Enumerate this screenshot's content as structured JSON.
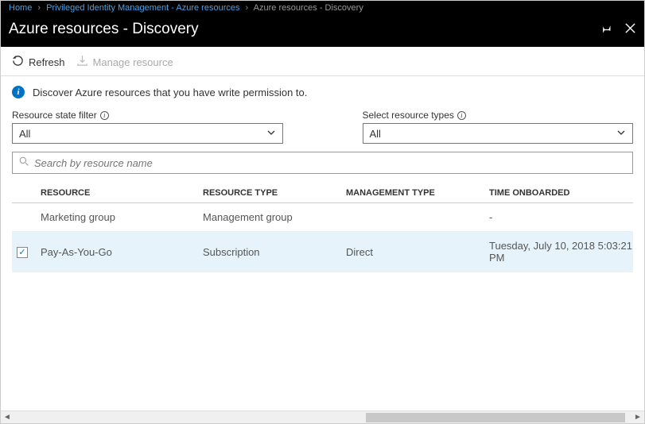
{
  "breadcrumb": {
    "home": "Home",
    "pim": "Privileged Identity Management - Azure resources",
    "current": "Azure resources - Discovery"
  },
  "title": "Azure resources - Discovery",
  "toolbar": {
    "refresh": "Refresh",
    "manage": "Manage resource"
  },
  "banner": "Discover Azure resources that you have write permission to.",
  "filters": {
    "state_label": "Resource state filter",
    "state_value": "All",
    "type_label": "Select resource types",
    "type_value": "All"
  },
  "search": {
    "placeholder": "Search by resource name"
  },
  "columns": {
    "resource": "RESOURCE",
    "type": "RESOURCE TYPE",
    "mgmt": "MANAGEMENT TYPE",
    "time": "TIME ONBOARDED"
  },
  "rows": [
    {
      "selected": false,
      "resource": "Marketing group",
      "type": "Management group",
      "mgmt": "",
      "time": "-"
    },
    {
      "selected": true,
      "resource": "Pay-As-You-Go",
      "type": "Subscription",
      "mgmt": "Direct",
      "time": "Tuesday, July 10, 2018 5:03:21 PM"
    }
  ]
}
